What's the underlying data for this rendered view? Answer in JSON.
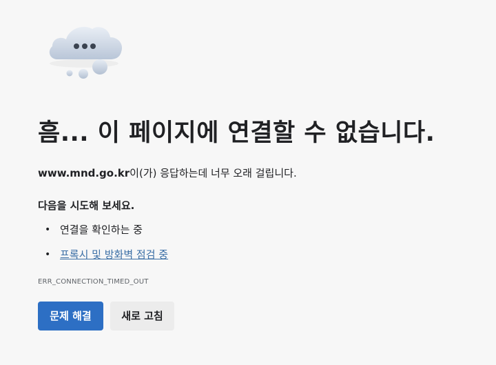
{
  "icon": "cloud-thinking-icon",
  "title": "흠... 이 페이지에 연결할 수 없습니다.",
  "summary": {
    "host": "www.mnd.go.kr",
    "message": "이(가) 응답하는데 너무 오래 걸립니다."
  },
  "suggestions": {
    "heading": "다음을 시도해 보세요.",
    "items": [
      {
        "label": "연결을 확인하는 중",
        "link": false
      },
      {
        "label": "프록시 및 방화벽 점검 중",
        "link": true
      }
    ]
  },
  "error_code": "ERR_CONNECTION_TIMED_OUT",
  "buttons": {
    "troubleshoot": "문제 해결",
    "refresh": "새로 고침"
  },
  "colors": {
    "background": "#f7f7f7",
    "primary_button": "#2d6fc4",
    "secondary_button": "#ececec",
    "link": "#3a6ea5"
  }
}
